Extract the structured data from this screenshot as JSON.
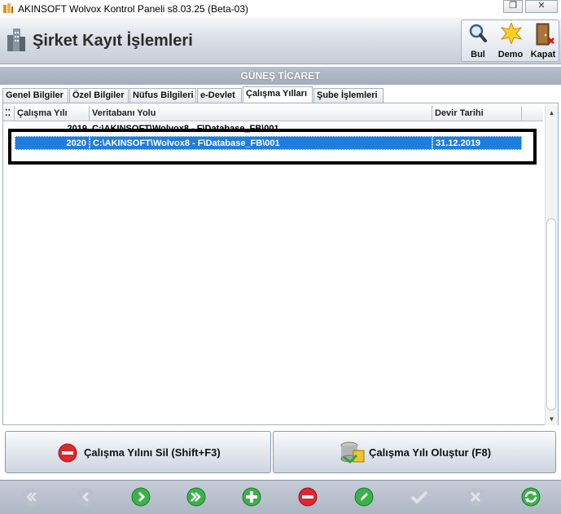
{
  "window": {
    "title": "AKINSOFT Wolvox Kontrol Paneli s8.03.25 (Beta-03)",
    "restore_glyph": "❐",
    "close_glyph": "✕"
  },
  "header": {
    "title": "Şirket Kayıt İşlemleri",
    "toolbar": [
      {
        "label": "Bul",
        "icon": "magnifier-icon"
      },
      {
        "label": "Demo",
        "icon": "starburst-icon"
      },
      {
        "label": "Kapat",
        "icon": "door-exit-icon"
      }
    ]
  },
  "company_name": "GÜNEŞ TİCARET",
  "tabs": [
    {
      "label": "Genel Bilgiler",
      "active": false
    },
    {
      "label": "Özel Bilgiler",
      "active": false
    },
    {
      "label": "Nüfus Bilgileri",
      "active": false
    },
    {
      "label": "e-Devlet",
      "active": false
    },
    {
      "label": "Çalışma Yılları",
      "active": true
    },
    {
      "label": "Şube İşlemleri",
      "active": false
    }
  ],
  "grid": {
    "columns": [
      "Çalışma Yılı",
      "Veritabanı Yolu",
      "Devir Tarihi"
    ],
    "rows": [
      {
        "year": "2019",
        "path": "C:\\AKINSOFT\\Wolvox8 - F\\Database_FB\\001",
        "date": ""
      },
      {
        "year": "2020",
        "path": "C:\\AKINSOFT\\Wolvox8 - F\\Database_FB\\001",
        "date": "31.12.2019",
        "selected": true
      }
    ]
  },
  "buttons": {
    "delete_year": "Çalışma Yılını Sil (Shift+F3)",
    "create_year": "Çalışma Yılı Oluştur (F8)"
  },
  "navigation": [
    {
      "icon": "first-record-icon",
      "enabled": false
    },
    {
      "icon": "previous-record-icon",
      "enabled": false
    },
    {
      "icon": "next-record-icon",
      "enabled": true
    },
    {
      "icon": "last-record-icon",
      "enabled": true
    },
    {
      "icon": "add-record-icon",
      "enabled": true
    },
    {
      "icon": "delete-record-icon",
      "enabled": true
    },
    {
      "icon": "edit-record-icon",
      "enabled": true
    },
    {
      "icon": "save-record-icon",
      "enabled": false
    },
    {
      "icon": "cancel-record-icon",
      "enabled": false
    },
    {
      "icon": "refresh-icon",
      "enabled": true
    }
  ],
  "colors": {
    "selection": "#1f7de0",
    "nav_green": "#3bb24a",
    "nav_red": "#e0262e",
    "nav_disabled": "#b9c1cc"
  }
}
